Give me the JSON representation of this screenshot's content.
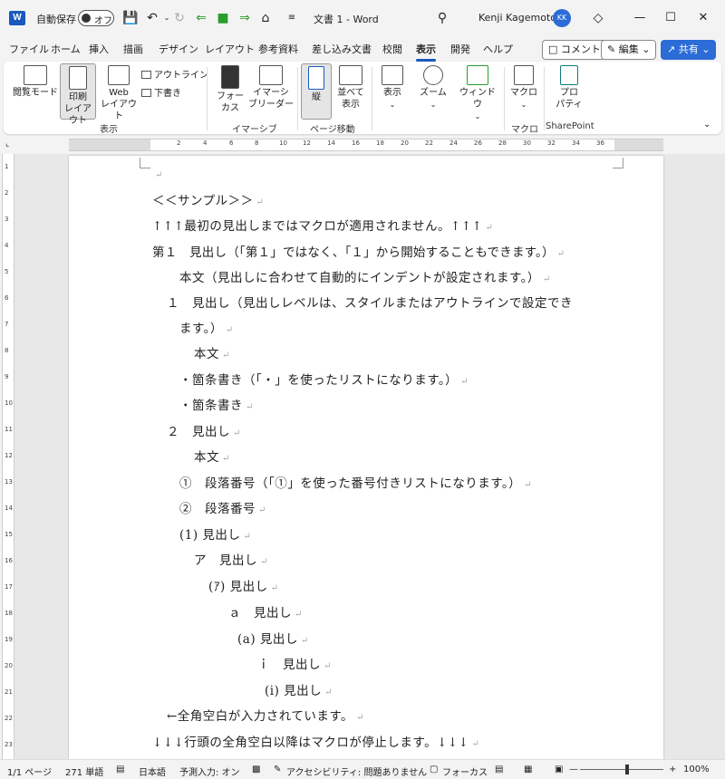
{
  "titlebar": {
    "app_logo": "W",
    "autosave_label": "自動保存",
    "autosave_state": "オフ",
    "doc_title": "文書 1 - Word",
    "user_name": "Kenji Kagemoto",
    "user_initials": "KK"
  },
  "menu": {
    "tabs": [
      "ファイル",
      "ホーム",
      "挿入",
      "描画",
      "デザイン",
      "レイアウト",
      "参考資料",
      "差し込み文書",
      "校閲",
      "表示",
      "開発",
      "ヘルプ"
    ],
    "active_tab": "表示",
    "comment_label": "コメント",
    "edit_label": "編集",
    "share_label": "共有"
  },
  "ribbon": {
    "read_mode": "閲覧モード",
    "print_layout_1": "印刷",
    "print_layout_2": "レイアウト",
    "web_layout_1": "Web",
    "web_layout_2": "レイアウト",
    "outline": "アウトライン",
    "draft": "下書き",
    "group_view": "表示",
    "focus_1": "フォー",
    "focus_2": "カス",
    "immersive_1": "イマーシ",
    "immersive_2": "ブリーダー",
    "group_immersive": "イマーシブ",
    "vertical": "縦",
    "side_1": "並べて",
    "side_2": "表示",
    "group_page": "ページ移動",
    "show": "表示",
    "zoom": "ズーム",
    "window": "ウィンドウ",
    "macro": "マクロ",
    "group_macro": "マクロ",
    "props_1": "プロ",
    "props_2": "パティ",
    "group_sharepoint": "SharePoint"
  },
  "ruler": {
    "h_numbers": [
      "2",
      "4",
      "6",
      "8",
      "10",
      "12",
      "14",
      "16",
      "18",
      "20",
      "22",
      "24",
      "26",
      "28",
      "30",
      "32",
      "34",
      "36",
      "38",
      "40"
    ],
    "v_numbers": [
      "1",
      "2",
      "3",
      "4",
      "5",
      "6",
      "7",
      "8",
      "9",
      "10",
      "11",
      "12",
      "13",
      "14",
      "15",
      "16",
      "17",
      "18",
      "19",
      "20",
      "21",
      "22",
      "23"
    ]
  },
  "document": {
    "lines": [
      "",
      "＜＜サンプル＞＞",
      "↑↑↑最初の見出しまではマクロが適用されません。↑↑↑",
      "第１　見出し（「第１」ではなく、「１」から開始することもできます。）",
      "本文（見出しに合わせて自動的にインデントが設定されます。）",
      "１　見出し（見出しレベルは、スタイルまたはアウトラインで設定でき",
      "ます。）",
      "本文",
      "・箇条書き（「・」を使ったリストになります。）",
      "・箇条書き",
      "２　見出し",
      "本文",
      "①　段落番号（「①」を使った番号付きリストになります。）",
      "②　段落番号",
      "(1) 見出し",
      "ア　見出し",
      "(ｱ) 見出し",
      "ａ　見出し",
      "(a) 見出し",
      "ｉ　見出し",
      "(i) 見出し",
      "←全角空白が入力されています。",
      "↓↓↓行頭の全角空白以降はマクロが停止します。↓↓↓"
    ]
  },
  "status": {
    "page": "1/1 ページ",
    "words": "271 単語",
    "language": "日本語",
    "predict": "予測入力: オン",
    "accessibility": "アクセシビリティ: 問題ありません",
    "focus": "フォーカス",
    "zoom": "100%",
    "zoom_percent": 100
  },
  "colors": {
    "accent": "#185abd",
    "share": "#2b6cd6"
  }
}
